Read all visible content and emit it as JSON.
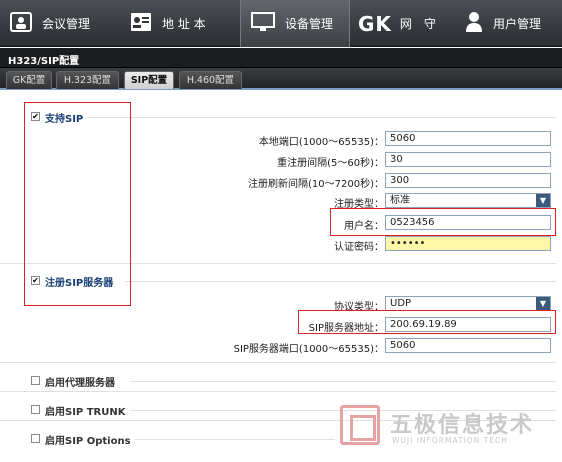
{
  "topnav": {
    "items": [
      {
        "label": "会议管理",
        "icon": "meeting-icon"
      },
      {
        "label": "地 址 本",
        "icon": "address-book-icon"
      },
      {
        "label": "设备管理",
        "icon": "monitor-icon",
        "active": true
      },
      {
        "label": "网　守",
        "prefix": "GK",
        "icon": "gk-icon"
      },
      {
        "label": "用户管理",
        "icon": "user-icon"
      }
    ]
  },
  "section_title": "H323/SIP配置",
  "tabs": [
    "GK配置",
    "H.323配置",
    "SIP配置",
    "H.460配置"
  ],
  "sip": {
    "enable_sip": {
      "label": "支持SIP",
      "checked": true
    },
    "local_port": {
      "label": "本地端口(1000～65535)：",
      "value": "5060"
    },
    "reregister_interval": {
      "label": "重注册间隔(5～60秒)：",
      "value": "30"
    },
    "register_refresh": {
      "label": "注册刷新间隔(10～7200秒)：",
      "value": "300"
    },
    "register_type": {
      "label": "注册类型：",
      "value": "标准"
    },
    "username": {
      "label": "用户名：",
      "value": "0523456"
    },
    "auth_password": {
      "label": "认证密码：",
      "value": "••••••"
    },
    "register_server": {
      "label": "注册SIP服务器",
      "checked": true
    },
    "protocol_type": {
      "label": "协议类型：",
      "value": "UDP"
    },
    "server_address": {
      "label": "SIP服务器地址：",
      "value": "200.69.19.89"
    },
    "server_port": {
      "label": "SIP服务器端口(1000～65535)：",
      "value": "5060"
    },
    "enable_proxy": {
      "label": "启用代理服务器",
      "checked": false
    },
    "enable_trunk": {
      "label": "启用SIP TRUNK",
      "checked": false
    },
    "enable_options": {
      "label": "启用SIP Options",
      "checked": false
    }
  },
  "watermark": {
    "text": "五极信息技术",
    "subtext": "WUJI INFORMATION TECH"
  },
  "colors": {
    "accent_red": "#dd2222",
    "password_bg": "#fdf7a8",
    "nav_bg": "#3a3d41"
  }
}
